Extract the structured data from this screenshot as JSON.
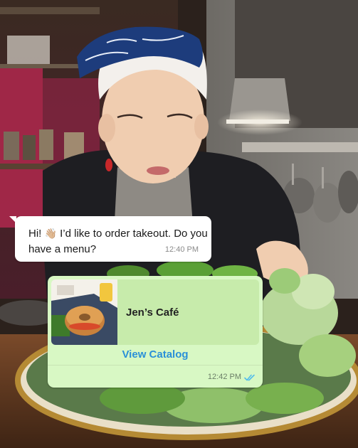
{
  "chat": {
    "incoming": {
      "text_before_emoji": "Hi! ",
      "emoji": "👋🏼",
      "text_after_emoji": " I’d like to order takeout. Do you have a menu?",
      "time": "12:40 PM"
    },
    "outgoing": {
      "shop_name": "Jen’s Café",
      "button_label": "View Catalog",
      "time": "12:42 PM",
      "status_icon": "double-check-read-icon"
    }
  },
  "colors": {
    "incoming_bubble": "#ffffff",
    "outgoing_bubble": "#d8f8c4",
    "catalog_card": "#c7ebab",
    "link_blue": "#2a90d8",
    "read_ticks": "#53bdeb"
  }
}
